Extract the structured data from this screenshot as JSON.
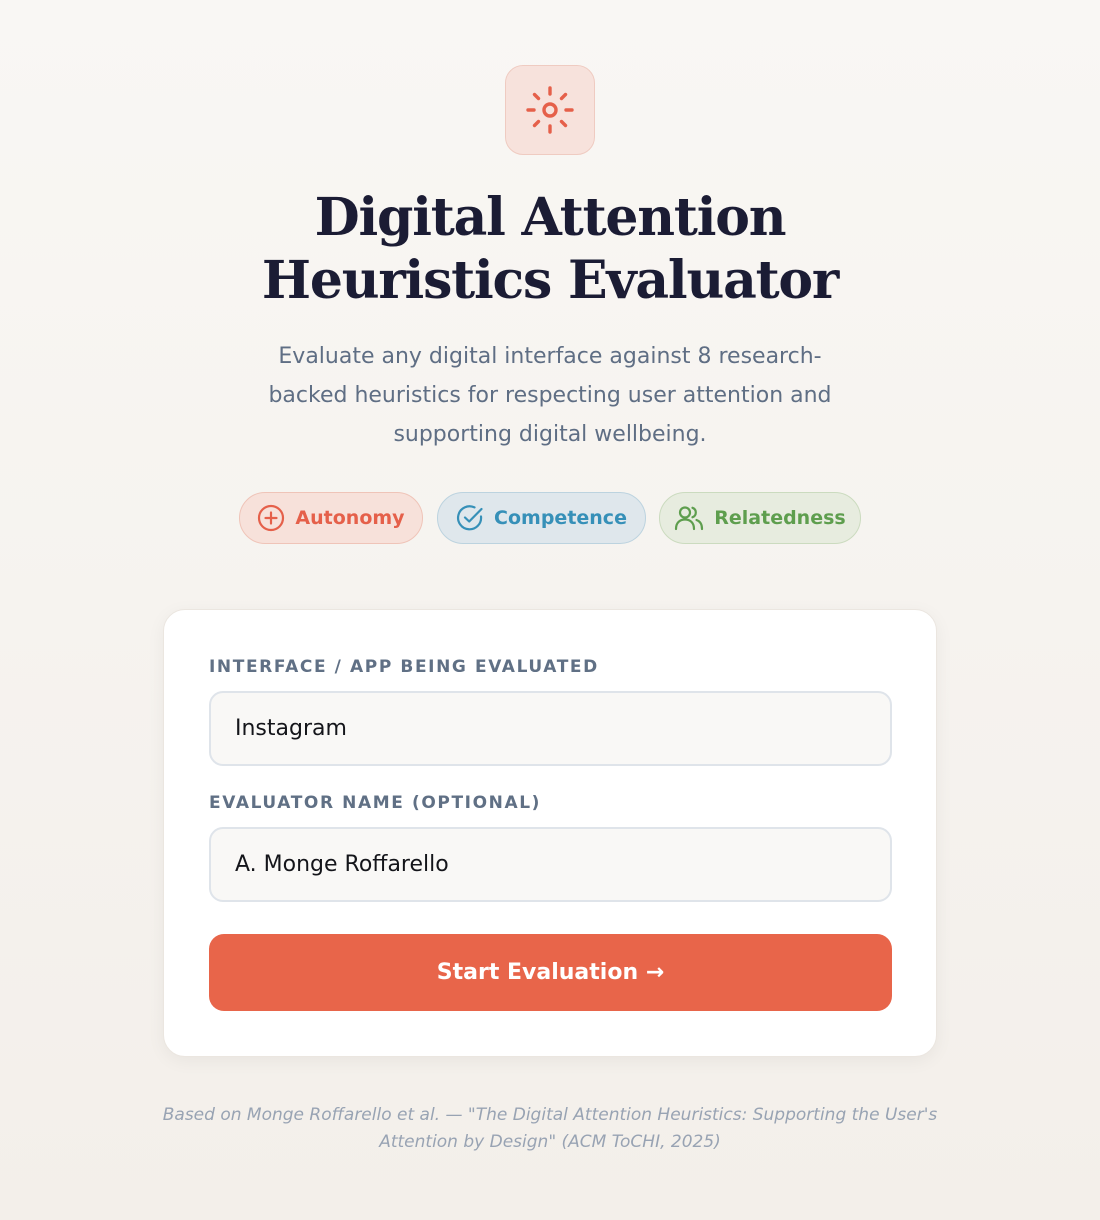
{
  "header": {
    "logo_icon": "sun-icon",
    "title_line1": "Digital Attention",
    "title_line2": "Heuristics Evaluator",
    "subtitle": "Evaluate any digital interface against 8 research-backed heuristics for respecting user attention and supporting digital wellbeing."
  },
  "pills": [
    {
      "label": "Autonomy",
      "icon": "plus-circle-icon",
      "color": "#e5604a"
    },
    {
      "label": "Competence",
      "icon": "check-circle-icon",
      "color": "#3690b8"
    },
    {
      "label": "Relatedness",
      "icon": "users-icon",
      "color": "#5e9e4e"
    }
  ],
  "form": {
    "interface_label": "INTERFACE / APP BEING EVALUATED",
    "interface_value": "Instagram",
    "evaluator_label": "EVALUATOR NAME (OPTIONAL)",
    "evaluator_value": "A. Monge Roffarello",
    "submit_label": "Start Evaluation →"
  },
  "footer": {
    "citation": "Based on Monge Roffarello et al. — \"The Digital Attention Heuristics: Supporting the User's Attention by Design\" (ACM ToCHI, 2025)"
  },
  "colors": {
    "accent": "#e8654a",
    "title": "#1b1c34",
    "muted": "#5f6e84"
  }
}
